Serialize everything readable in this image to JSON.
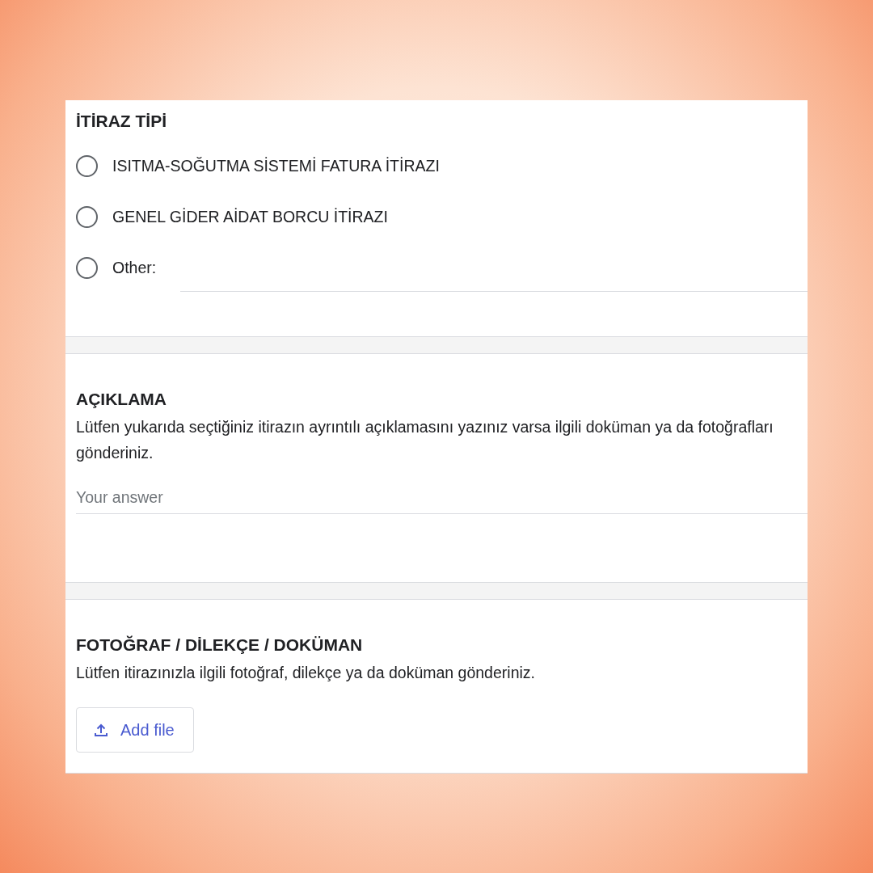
{
  "sections": [
    {
      "kind": "choice",
      "title": "İTİRAZ TİPİ",
      "options": [
        {
          "kind": "option",
          "label": "ISITMA-SOĞUTMA SİSTEMİ FATURA İTİRAZI",
          "selected": false
        },
        {
          "kind": "option",
          "label": "GENEL GİDER AİDAT BORCU İTİRAZI",
          "selected": false
        },
        {
          "kind": "other",
          "label": "Other:",
          "selected": false
        }
      ]
    },
    {
      "kind": "text",
      "title": "AÇIKLAMA",
      "description": "Lütfen yukarıda seçtiğiniz itirazın ayrıntılı açıklamasını yazınız varsa ilgili doküman ya da fotoğrafları gönderiniz.",
      "placeholder": "Your answer"
    },
    {
      "kind": "file",
      "title": "FOTOĞRAF / DİLEKÇE / DOKÜMAN",
      "description": "Lütfen itirazınızla ilgili fotoğraf, dilekçe ya da doküman gönderiniz.",
      "button": "Add file"
    }
  ]
}
